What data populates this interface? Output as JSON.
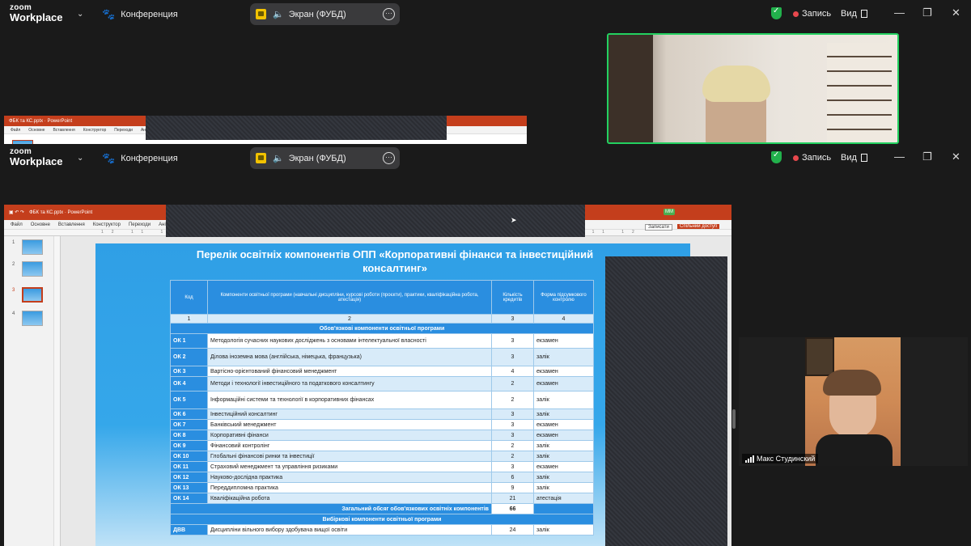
{
  "zoom": {
    "logo_line1": "zoom",
    "logo_line2": "Workplace",
    "conference": "Конференция",
    "share_label": "Экран (ФУБД)",
    "record": "Запись",
    "view": "Вид"
  },
  "ppt": {
    "title": "ФБК та КС.pptx  ·  PowerPoint",
    "menu": [
      "Файл",
      "Основне",
      "Вставлення",
      "Конструктор",
      "Переходи",
      "Анімація"
    ],
    "record_btn": "Записати",
    "share_btn": "Спільний доступ",
    "avatar": "ММ",
    "thumb_numbers": [
      "1",
      "2",
      "3",
      "4"
    ],
    "active_thumb": 3
  },
  "slide": {
    "title": "Перелік освітніх компонентів ОПП «Корпоративні фінанси та інвестиційний консалтинг»",
    "headers": {
      "code": "Код",
      "component": "Компоненти освітньої програми (навчальні дисципліни, курсові роботи (проєкти), практики, кваліфікаційна робота, атестація)",
      "credits": "Кількість кредитів",
      "form": "Форма підсумкового контролю"
    },
    "col_numbers": [
      "1",
      "2",
      "3",
      "4"
    ],
    "section1": "Обов'язкові компоненти освітньої програми",
    "rows": [
      {
        "code": "ОК 1",
        "name": "Методологія сучасних наукових досліджень з основами інтелектуальної власності",
        "credits": "3",
        "form": "екзамен"
      },
      {
        "code": "ОК 2",
        "name": "Ділова іноземна мова (англійська, німецька, французька)",
        "credits": "3",
        "form": "залік"
      },
      {
        "code": "ОК 3",
        "name": "Вартісно-орієнтований фінансовий менеджмент",
        "credits": "4",
        "form": "екзамен"
      },
      {
        "code": "ОК 4",
        "name": "Методи і технології інвестиційного та податкового консалтингу",
        "credits": "2",
        "form": "екзамен"
      },
      {
        "code": "ОК 5",
        "name": "Інформаційні системи та технології в корпоративних фінансах",
        "credits": "2",
        "form": "залік"
      },
      {
        "code": "ОК 6",
        "name": "Інвестиційний консалтинг",
        "credits": "3",
        "form": "залік"
      },
      {
        "code": "ОК 7",
        "name": "Банківський менеджмент",
        "credits": "3",
        "form": "екзамен"
      },
      {
        "code": "ОК 8",
        "name": "Корпоративні фінанси",
        "credits": "3",
        "form": "екзамен"
      },
      {
        "code": "ОК 9",
        "name": "Фінансовий контролінг",
        "credits": "2",
        "form": "залік"
      },
      {
        "code": "ОК 10",
        "name": "Глобальні фінансові ринки та інвестиції",
        "credits": "2",
        "form": "залік"
      },
      {
        "code": "ОК 11",
        "name": "Страховий менеджмент та управління ризиками",
        "credits": "3",
        "form": "екзамен"
      },
      {
        "code": "ОК 12",
        "name": "Науково-дослідна практика",
        "credits": "6",
        "form": "залік"
      },
      {
        "code": "ОК 13",
        "name": "Переддипломна практика",
        "credits": "9",
        "form": "залік"
      },
      {
        "code": "ОК 14",
        "name": "Кваліфікаційна робота",
        "credits": "21",
        "form": "атестація"
      }
    ],
    "total_label": "Загальний обсяг обов'язкових освітніх компонентів",
    "total_value": "66",
    "section2": "Вибіркові компоненти освітньої програми",
    "last_row": {
      "code": "ДВВ",
      "name": "Дисципліни вільного вибору здобувача вищої освіти",
      "credits": "24",
      "form": "залік"
    }
  },
  "participants": {
    "speaker": "Макс Студинский"
  }
}
